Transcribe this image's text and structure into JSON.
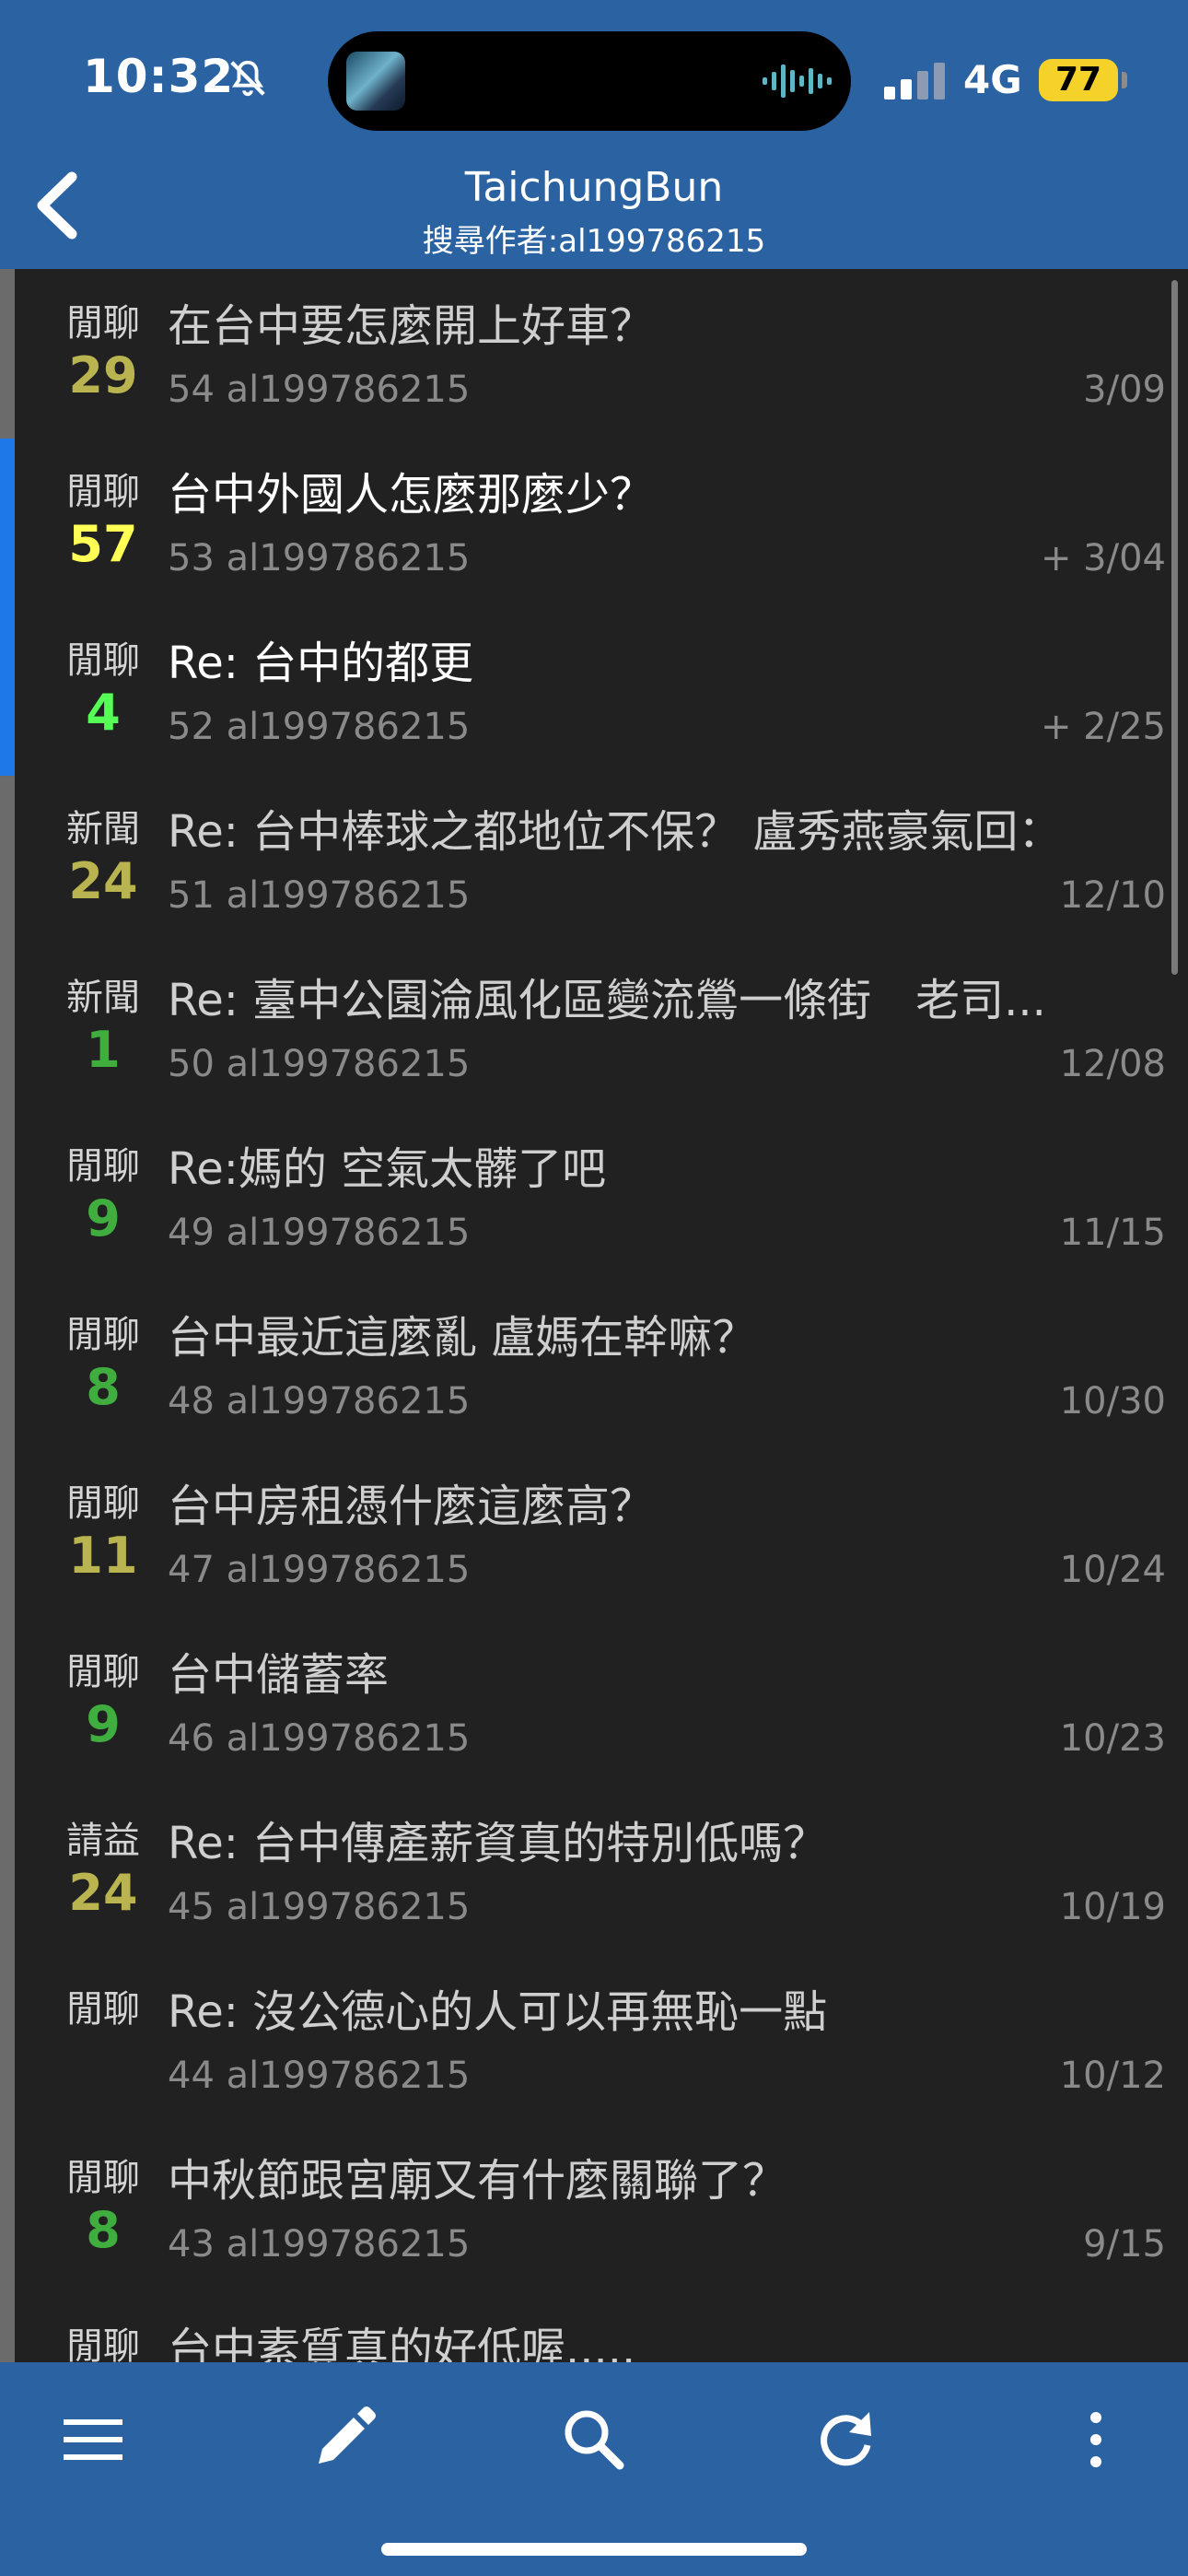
{
  "status_bar": {
    "time": "10:32",
    "network": "4G",
    "battery": "77",
    "icons": [
      "bell-off-icon",
      "audio-wave-icon",
      "signal-icon",
      "battery-icon"
    ]
  },
  "header": {
    "title": "TaichungBun",
    "subtitle": "搜尋作者:al199786215",
    "back_icon": "chevron-left-icon"
  },
  "colors": {
    "bar_bg": "#2a62a2",
    "list_bg": "#212121",
    "active_strip": "#1f78e8",
    "count_olive": "#b9b350",
    "count_yellow": "#ffff55",
    "count_green": "#55ff55",
    "count_dkgreen": "#3fae3f"
  },
  "posts": [
    {
      "category": "閒聊",
      "count": "29",
      "count_color": "#b9b350",
      "title": "在台中要怎麼開上好車？",
      "number": "54",
      "author": "al199786215",
      "date": "3/09",
      "unread": false
    },
    {
      "category": "閒聊",
      "count": "57",
      "count_color": "#ffff55",
      "title": "台中外國人怎麼那麼少？",
      "number": "53",
      "author": "al199786215",
      "date": "+ 3/04",
      "unread": true
    },
    {
      "category": "閒聊",
      "count": "4",
      "count_color": "#55ff55",
      "title": "Re: 台中的都更",
      "number": "52",
      "author": "al199786215",
      "date": "+ 2/25",
      "unread": true
    },
    {
      "category": "新聞",
      "count": "24",
      "count_color": "#b9b350",
      "title": "Re: 台中棒球之都地位不保？ 盧秀燕豪氣回：",
      "number": "51",
      "author": "al199786215",
      "date": "12/10",
      "unread": false
    },
    {
      "category": "新聞",
      "count": "1",
      "count_color": "#3fae3f",
      "title": "Re: 臺中公園淪風化區變流鶯一條街　老司...",
      "number": "50",
      "author": "al199786215",
      "date": "12/08",
      "unread": false
    },
    {
      "category": "閒聊",
      "count": "9",
      "count_color": "#3fae3f",
      "title": "Re:媽的 空氣太髒了吧",
      "number": "49",
      "author": "al199786215",
      "date": "11/15",
      "unread": false
    },
    {
      "category": "閒聊",
      "count": "8",
      "count_color": "#3fae3f",
      "title": "台中最近這麼亂 盧媽在幹嘛？",
      "number": "48",
      "author": "al199786215",
      "date": "10/30",
      "unread": false
    },
    {
      "category": "閒聊",
      "count": "11",
      "count_color": "#b9b350",
      "title": "台中房租憑什麼這麼高？",
      "number": "47",
      "author": "al199786215",
      "date": "10/24",
      "unread": false
    },
    {
      "category": "閒聊",
      "count": "9",
      "count_color": "#3fae3f",
      "title": "台中儲蓄率",
      "number": "46",
      "author": "al199786215",
      "date": "10/23",
      "unread": false
    },
    {
      "category": "請益",
      "count": "24",
      "count_color": "#b9b350",
      "title": "Re: 台中傳產薪資真的特別低嗎？",
      "number": "45",
      "author": "al199786215",
      "date": "10/19",
      "unread": false
    },
    {
      "category": "閒聊",
      "count": "",
      "count_color": "#3fae3f",
      "title": "Re:  沒公德心的人可以再無恥一點",
      "number": "44",
      "author": "al199786215",
      "date": "10/12",
      "unread": false
    },
    {
      "category": "閒聊",
      "count": "8",
      "count_color": "#3fae3f",
      "title": "中秋節跟宮廟又有什麼關聯了？",
      "number": "43",
      "author": "al199786215",
      "date": "9/15",
      "unread": false
    },
    {
      "category": "閒聊",
      "count": "",
      "count_color": "#3fae3f",
      "title": "台中素質真的好低喔.....",
      "number": "",
      "author": "",
      "date": "",
      "unread": false
    }
  ],
  "toolbar": {
    "icons": [
      "menu-icon",
      "pencil-icon",
      "search-icon",
      "refresh-icon",
      "more-vert-icon"
    ]
  }
}
